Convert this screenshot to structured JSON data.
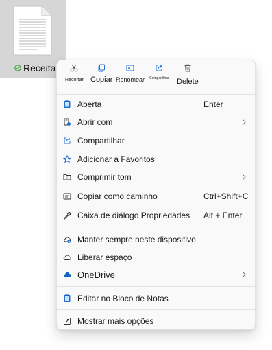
{
  "file": {
    "name": "Receita"
  },
  "toolbar": {
    "cut_label": "Recortar",
    "copy_label": "Copiar",
    "rename_label": "Renomear",
    "share_label": "Compartilhar",
    "delete_label": "Delete"
  },
  "menu": {
    "open": {
      "label": "Aberta",
      "shortcut": "Enter"
    },
    "open_with": {
      "label": "Abrir com"
    },
    "share": {
      "label": "Compartilhar"
    },
    "favorites": {
      "label": "Adicionar a Favoritos"
    },
    "compress": {
      "label": "Comprimir tom"
    },
    "copy_path": {
      "label": "Copiar como caminho",
      "shortcut": "Ctrl+Shift+C"
    },
    "properties": {
      "label": "Caixa de diálogo Propriedades",
      "shortcut": "Alt + Enter"
    },
    "keep_on_device": {
      "label": "Manter sempre neste dispositivo"
    },
    "free_space": {
      "label": "Liberar espaço"
    },
    "onedrive": {
      "label": "OneDrive"
    },
    "edit_notepad": {
      "label": "Editar no Bloco de Notas"
    },
    "more_options": {
      "label": "Mostrar mais opções"
    }
  },
  "colors": {
    "accent": "#1e6fd9",
    "onedrive": "#1565c0",
    "sync_green": "#3a9a3a",
    "tile_bg": "#d6d6d6",
    "menu_bg": "#f9f9f9"
  },
  "icons": {
    "file": "text-document-icon",
    "sync_status": "synced-check-icon",
    "cut": "scissors-icon",
    "copy": "copy-icon",
    "rename": "rename-icon",
    "share": "share-icon",
    "delete": "trash-icon",
    "open": "notepad-icon",
    "open_with": "open-with-icon",
    "share_item": "share-icon",
    "favorites": "star-icon",
    "compress": "zip-folder-icon",
    "copy_path": "copy-path-icon",
    "properties": "wrench-icon",
    "keep_on_device": "cloud-keep-icon",
    "free_space": "cloud-outline-icon",
    "onedrive": "onedrive-cloud-icon",
    "edit_notepad": "notepad-icon",
    "more_options": "more-options-icon",
    "submenu": "chevron-right-icon"
  }
}
